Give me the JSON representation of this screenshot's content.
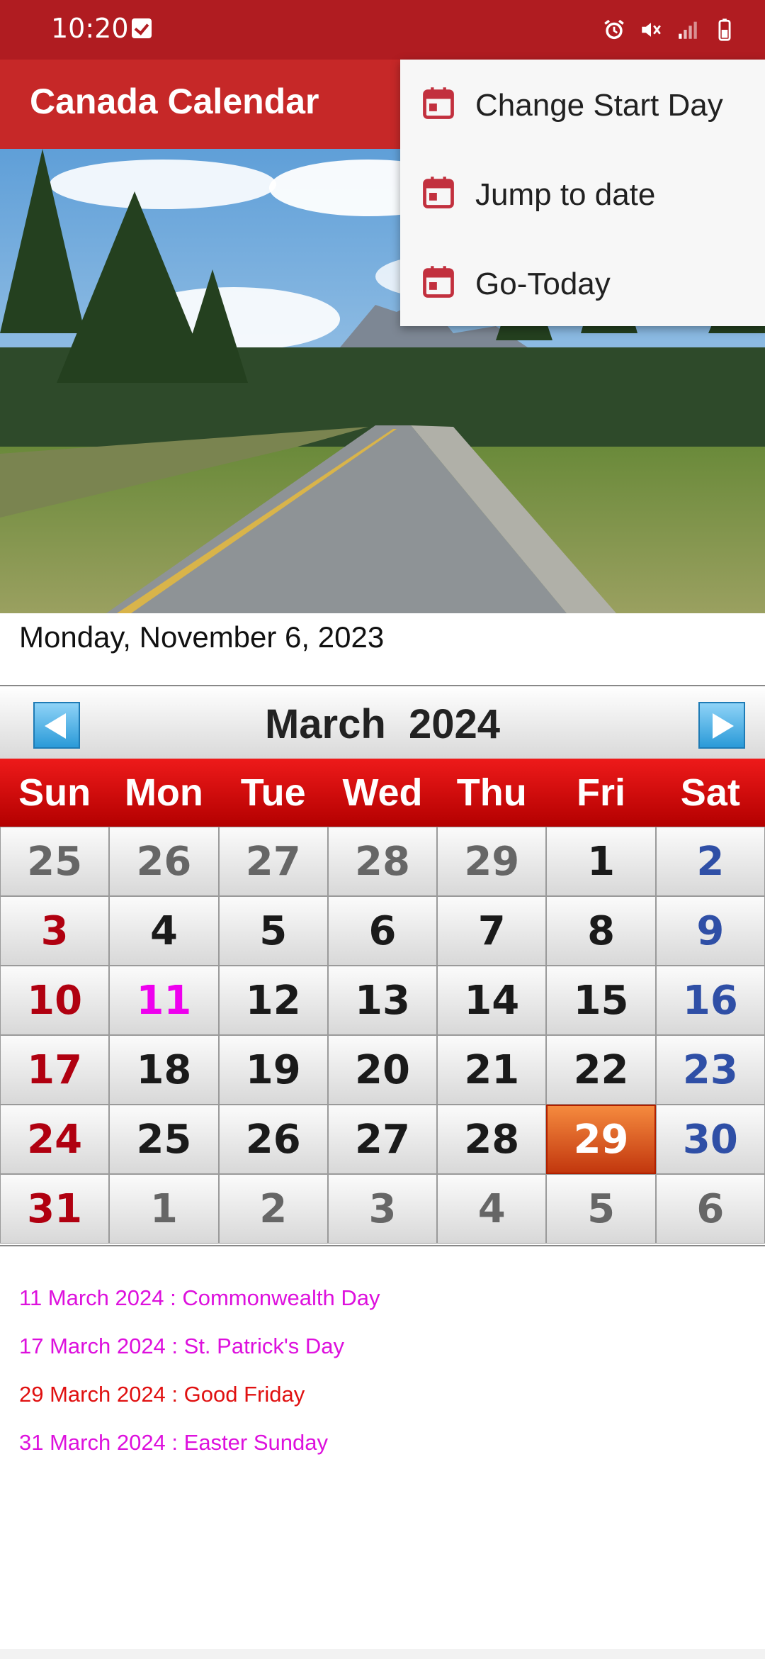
{
  "status_bar": {
    "time": "10:20",
    "icons": [
      "check-icon",
      "alarm-icon",
      "mute-icon",
      "signal-icon",
      "battery-icon"
    ]
  },
  "app_bar": {
    "title": "Canada Calendar",
    "color": "#c62828"
  },
  "overflow_menu": {
    "items": [
      {
        "label": "Change Start Day",
        "icon": "calendar-icon"
      },
      {
        "label": "Jump to date",
        "icon": "calendar-icon"
      },
      {
        "label": "Go-Today",
        "icon": "calendar-icon"
      }
    ]
  },
  "hero_image": {
    "description_icon": "landscape-photo"
  },
  "today_text": "Monday, November 6, 2023",
  "calendar": {
    "month_title": "March  2024",
    "prev_icon": "arrow-left-icon",
    "next_icon": "arrow-right-icon",
    "weekdays": [
      "Sun",
      "Mon",
      "Tue",
      "Wed",
      "Thu",
      "Fri",
      "Sat"
    ],
    "weeks": [
      [
        "25",
        "26",
        "27",
        "28",
        "29",
        "1",
        "2"
      ],
      [
        "3",
        "4",
        "5",
        "6",
        "7",
        "8",
        "9"
      ],
      [
        "10",
        "11",
        "12",
        "13",
        "14",
        "15",
        "16"
      ],
      [
        "17",
        "18",
        "19",
        "20",
        "21",
        "22",
        "23"
      ],
      [
        "24",
        "25",
        "26",
        "27",
        "28",
        "29",
        "30"
      ],
      [
        "31",
        "1",
        "2",
        "3",
        "4",
        "5",
        "6"
      ]
    ],
    "selected_day": "29",
    "colors": {
      "sunday": "#b00010",
      "saturday": "#2f4fa6",
      "holiday": "#ee00ee",
      "selected_bg": "#e0561f"
    }
  },
  "events": [
    {
      "text": "11 March 2024 : Commonwealth Day",
      "color": "#dd10dd"
    },
    {
      "text": "17 March 2024 : St. Patrick's Day",
      "color": "#dd10dd"
    },
    {
      "text": "29 March 2024 : Good Friday",
      "color": "#e01010"
    },
    {
      "text": "31 March 2024 : Easter Sunday",
      "color": "#dd10dd"
    }
  ]
}
